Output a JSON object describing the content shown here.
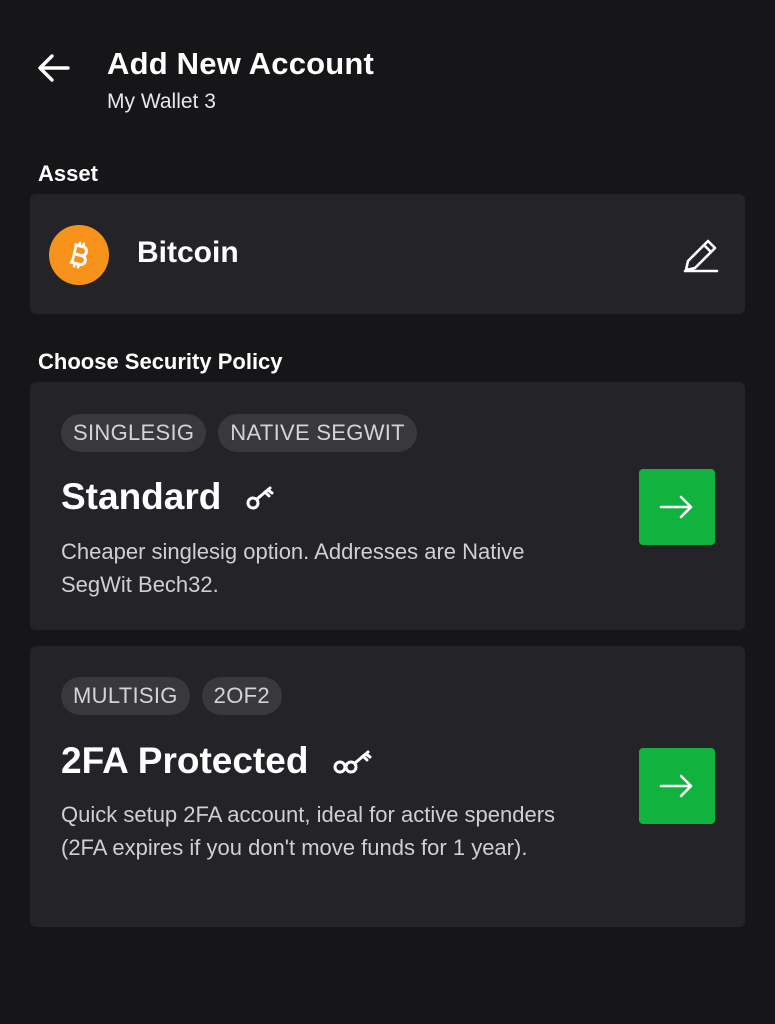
{
  "header": {
    "title": "Add New Account",
    "subtitle": "My Wallet 3"
  },
  "asset": {
    "section_label": "Asset",
    "name": "Bitcoin",
    "logo_color": "#f7931a",
    "logo_icon": "bitcoin-icon",
    "edit_icon": "pencil-icon"
  },
  "policy": {
    "section_label": "Choose Security Policy",
    "options": [
      {
        "tags": [
          "SINGLESIG",
          "NATIVE SEGWIT"
        ],
        "title": "Standard",
        "icon": "key-icon",
        "description": "Cheaper singlesig option. Addresses are Native SegWit Bech32."
      },
      {
        "tags": [
          "MULTISIG",
          "2OF2"
        ],
        "title": "2FA Protected",
        "icon": "two-keys-icon",
        "description": "Quick setup 2FA account, ideal for active spenders (2FA expires if you don't move funds for 1 year)."
      }
    ]
  },
  "colors": {
    "background": "#161619",
    "card": "#242428",
    "tag_bg": "#38383d",
    "accent_green": "#12b23e"
  }
}
